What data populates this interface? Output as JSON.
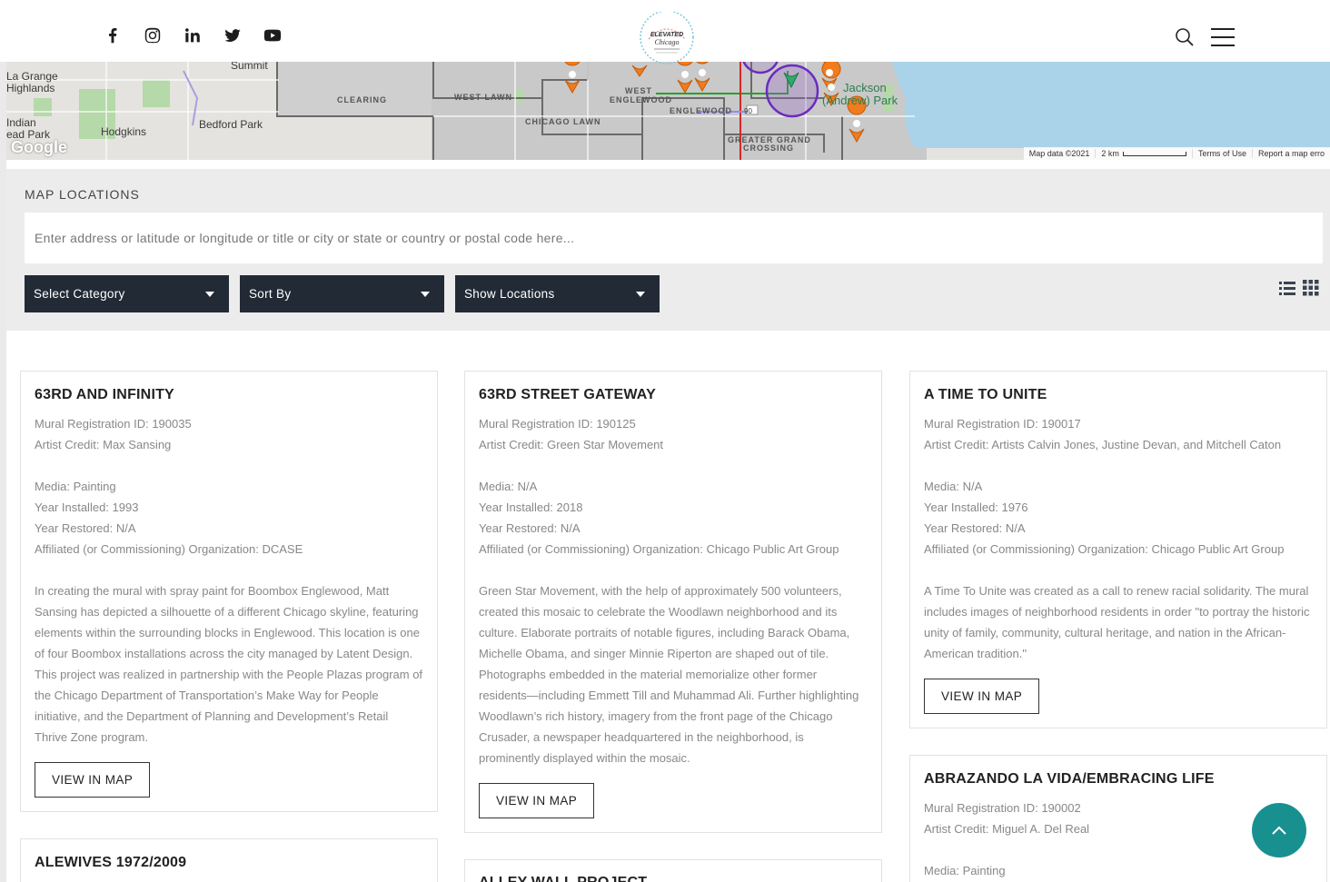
{
  "header": {
    "social": [
      "facebook-icon",
      "instagram-icon",
      "linkedin-icon",
      "twitter-icon",
      "youtube-icon"
    ],
    "logo": {
      "line1": "ELEVATED",
      "line2": "Chicago"
    }
  },
  "map": {
    "labels": {
      "la_grange": "La Grange",
      "highlands": "Highlands",
      "summit": "Summit",
      "indian": "Indian",
      "head_park": "ead Park",
      "hodgkins": "Hodgkins",
      "bedford_park": "Bedford Park",
      "clearing": "CLEARING",
      "west_lawn": "WEST LAWN",
      "chicago_lawn": "CHICAGO LAWN",
      "west": "WEST",
      "englewood_w": "ENGLEWOOD",
      "englewood": "ENGLEWOOD",
      "greater_grand": "GREATER GRAND",
      "crossing": "CROSSING",
      "jackson": "Jackson",
      "andrew_park": "(Andrew) Park",
      "route": "90"
    },
    "google": "Google",
    "footer": {
      "data": "Map data ©2021",
      "scale": "2 km",
      "terms": "Terms of Use",
      "report": "Report a map erro"
    }
  },
  "filters": {
    "title": "MAP LOCATIONS",
    "search_placeholder": "Enter address or latitude or longitude or title or city or state or country or postal code here...",
    "category": "Select Category",
    "sort": "Sort By",
    "show": "Show Locations"
  },
  "cards": [
    {
      "title": "63RD AND INFINITY",
      "reg": "Mural Registration ID: 190035",
      "artist": "Artist Credit: Max Sansing",
      "media": "Media: Painting",
      "year_installed": "Year Installed: 1993",
      "year_restored": "Year Restored: N/A",
      "org": "Affiliated (or Commissioning) Organization: DCASE",
      "desc": "In creating the mural with spray paint for Boombox Englewood, Matt Sansing has depicted a silhouette of a different Chicago skyline, featuring elements within the surrounding blocks in Englewood. This location is one of four Boombox installations across the city managed by Latent Design. This project was realized in partnership with the People Plazas program of the Chicago Department of Transportation’s Make Way for People initiative, and the Department of Planning and Development’s Retail Thrive Zone program.",
      "button": "VIEW IN MAP"
    },
    {
      "title": "63RD STREET GATEWAY",
      "reg": "Mural Registration ID: 190125",
      "artist": "Artist Credit: Green Star Movement",
      "media": "Media: N/A",
      "year_installed": "Year Installed: 2018",
      "year_restored": "Year Restored: N/A",
      "org": "Affiliated (or Commissioning) Organization: Chicago Public Art Group",
      "desc": "Green Star Movement, with the help of approximately 500 volunteers, created this mosaic to celebrate the Woodlawn neighborhood and its culture. Elaborate portraits of notable figures, including Barack Obama, Michelle Obama, and singer Minnie Riperton are shaped out of tile. Photographs embedded in the material memorialize other former residents—including Emmett Till and Muhammad Ali. Further highlighting Woodlawn’s rich history, imagery from the front page of the Chicago Crusader, a newspaper headquartered in the neighborhood, is prominently displayed within the mosaic.",
      "button": "VIEW IN MAP"
    },
    {
      "title": "A TIME TO UNITE",
      "reg": "Mural Registration ID: 190017",
      "artist": "Artist Credit: Artists Calvin Jones, Justine Devan, and Mitchell Caton",
      "media": "Media: N/A",
      "year_installed": "Year Installed: 1976",
      "year_restored": "Year Restored: N/A",
      "org": "Affiliated (or Commissioning) Organization: Chicago Public Art Group",
      "desc": "A Time To Unite was created as a call to renew racial solidarity. The mural includes images of neighborhood residents in order \"to portray the historic unity of family, community, cultural heritage, and nation in the African-American tradition.\"",
      "button": "VIEW IN MAP"
    },
    {
      "title": "ALEWIVES 1972/2009"
    },
    {
      "title": "ALLEY WALL PROJECT"
    },
    {
      "title": "ABRAZANDO LA VIDA/EMBRACING LIFE",
      "reg": "Mural Registration ID: 190002",
      "artist": "Artist Credit: Miguel A. Del Real",
      "media": "Media: Painting"
    }
  ],
  "colors": {
    "dark_select": "#222a36",
    "teal": "#189090",
    "marker": "#f07c1e",
    "water": "#aad3ea"
  }
}
